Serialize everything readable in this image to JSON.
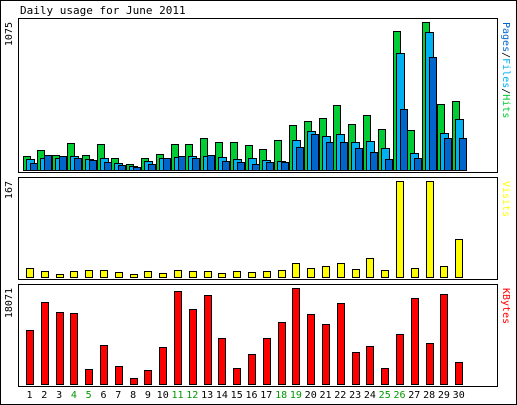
{
  "title": "Daily usage for June 2011",
  "colors": {
    "background": "#ffffff",
    "frame": "#000000",
    "hits": "#00cc33",
    "files": "#00b0f0",
    "pages": "#0066cc",
    "visits": "#ffff00",
    "kbytes": "#ff0000",
    "weekday_label": "#000000",
    "weekend_label": "#009900"
  },
  "chart_data": [
    {
      "type": "bar",
      "panel": "pages-files-hits",
      "legend": [
        "Pages",
        "Files",
        "Hits"
      ],
      "ymax_label": "1075",
      "categories": [
        "1",
        "2",
        "3",
        "4",
        "5",
        "6",
        "7",
        "8",
        "9",
        "10",
        "11",
        "12",
        "13",
        "14",
        "15",
        "16",
        "17",
        "18",
        "19",
        "20",
        "21",
        "22",
        "23",
        "24",
        "25",
        "26",
        "27",
        "28",
        "29",
        "30"
      ],
      "weekend_days": [
        4,
        5,
        11,
        12,
        18,
        19,
        25,
        26
      ],
      "series": [
        {
          "name": "Hits",
          "values": [
            100,
            145,
            110,
            195,
            110,
            190,
            85,
            45,
            85,
            115,
            190,
            190,
            230,
            200,
            200,
            185,
            150,
            215,
            330,
            355,
            380,
            475,
            335,
            400,
            300,
            1010,
            290,
            1075,
            480,
            500
          ]
        },
        {
          "name": "Files",
          "values": [
            80,
            90,
            90,
            100,
            80,
            85,
            50,
            30,
            65,
            85,
            95,
            100,
            105,
            95,
            80,
            90,
            70,
            65,
            220,
            285,
            250,
            260,
            200,
            210,
            160,
            850,
            120,
            1000,
            270,
            370
          ]
        },
        {
          "name": "Pages",
          "values": [
            50,
            110,
            100,
            85,
            75,
            55,
            35,
            20,
            45,
            85,
            100,
            85,
            110,
            65,
            60,
            40,
            55,
            60,
            170,
            260,
            200,
            200,
            160,
            130,
            80,
            440,
            90,
            820,
            230,
            230
          ]
        }
      ]
    },
    {
      "type": "bar",
      "panel": "visits",
      "legend": [
        "Visits"
      ],
      "ymax_label": "167",
      "categories": [
        "1",
        "2",
        "3",
        "4",
        "5",
        "6",
        "7",
        "8",
        "9",
        "10",
        "11",
        "12",
        "13",
        "14",
        "15",
        "16",
        "17",
        "18",
        "19",
        "20",
        "21",
        "22",
        "23",
        "24",
        "25",
        "26",
        "27",
        "28",
        "29",
        "30"
      ],
      "series": [
        {
          "name": "Visits",
          "values": [
            15,
            10,
            6,
            11,
            13,
            13,
            9,
            6,
            10,
            7,
            13,
            10,
            10,
            7,
            11,
            9,
            11,
            12,
            25,
            15,
            19,
            25,
            14,
            33,
            12,
            167,
            15,
            167,
            19,
            66
          ]
        }
      ]
    },
    {
      "type": "bar",
      "panel": "kbytes",
      "legend": [
        "KBytes"
      ],
      "ymax_label": "18071",
      "categories": [
        "1",
        "2",
        "3",
        "4",
        "5",
        "6",
        "7",
        "8",
        "9",
        "10",
        "11",
        "12",
        "13",
        "14",
        "15",
        "16",
        "17",
        "18",
        "19",
        "20",
        "21",
        "22",
        "23",
        "24",
        "25",
        "26",
        "27",
        "28",
        "29",
        "30"
      ],
      "series": [
        {
          "name": "KBytes",
          "values": [
            10350,
            15920,
            13850,
            13650,
            2930,
            7600,
            3470,
            1090,
            2760,
            7070,
            18070,
            14500,
            17210,
            8860,
            3130,
            5830,
            8930,
            11950,
            18560,
            13520,
            11630,
            15730,
            6120,
            7400,
            3180,
            9570,
            16700,
            7930,
            17460,
            4180
          ]
        }
      ]
    }
  ]
}
